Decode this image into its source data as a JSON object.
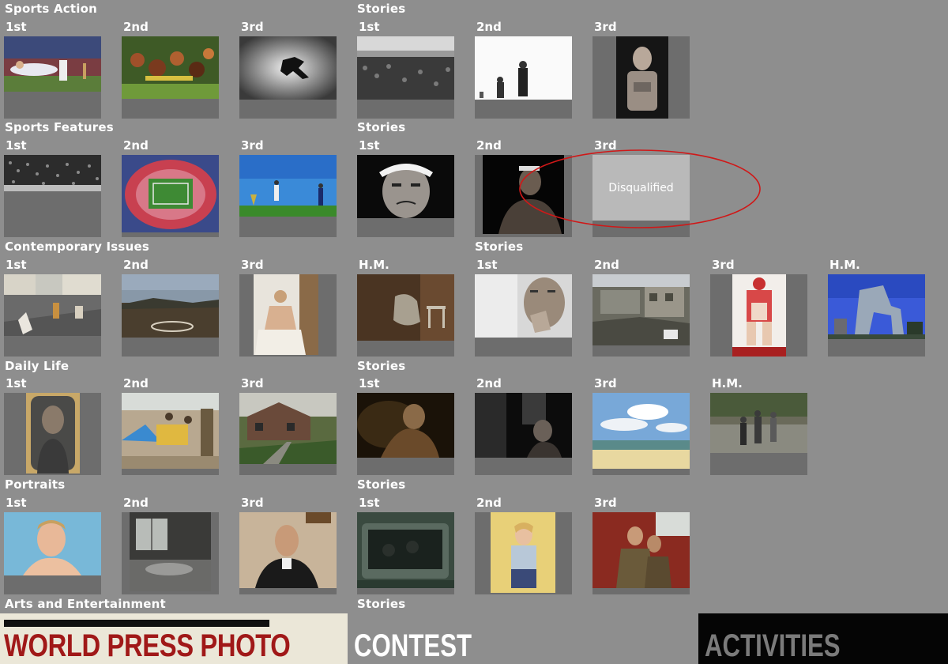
{
  "categories": [
    {
      "title": "Sports Action",
      "stories_title": "Stories",
      "singles": [
        {
          "rank": "1st",
          "photo": "cricket-catch"
        },
        {
          "rank": "2nd",
          "photo": "horse-race"
        },
        {
          "rank": "3rd",
          "photo": "diver-silhouette"
        }
      ],
      "stories": [
        {
          "rank": "1st",
          "photo": "crowd-waterfront"
        },
        {
          "rank": "2nd",
          "photo": "runners-white"
        },
        {
          "rank": "3rd",
          "photo": "athlete-portrait"
        }
      ]
    },
    {
      "title": "Sports Features",
      "stories_title": "Stories",
      "singles": [
        {
          "rank": "1st",
          "photo": "stadium-crowd"
        },
        {
          "rank": "2nd",
          "photo": "stadium-aerial"
        },
        {
          "rank": "3rd",
          "photo": "golfers-field"
        }
      ],
      "stories": [
        {
          "rank": "1st",
          "photo": "cyclist-face"
        },
        {
          "rank": "2nd",
          "photo": "boxer-dark"
        },
        {
          "rank": "3rd",
          "disqualified": "Disqualified"
        }
      ]
    },
    {
      "title": "Contemporary Issues",
      "stories_title": "Stories",
      "singles": [
        {
          "rank": "1st",
          "photo": "street-objects"
        },
        {
          "rank": "2nd",
          "photo": "field-landscape"
        },
        {
          "rank": "3rd",
          "photo": "woman-doorway"
        },
        {
          "rank": "H.M.",
          "photo": "chair-brown"
        }
      ],
      "stories": [
        {
          "rank": "1st",
          "photo": "man-thinking"
        },
        {
          "rank": "2nd",
          "photo": "wreckage"
        },
        {
          "rank": "3rd",
          "photo": "red-figure"
        },
        {
          "rank": "H.M.",
          "photo": "cctv-tower"
        }
      ]
    },
    {
      "title": "Daily Life",
      "stories_title": "Stories",
      "singles": [
        {
          "rank": "1st",
          "photo": "woman-window"
        },
        {
          "rank": "2nd",
          "photo": "market-scene"
        },
        {
          "rank": "3rd",
          "photo": "rural-house"
        }
      ],
      "stories": [
        {
          "rank": "1st",
          "photo": "girl-dark"
        },
        {
          "rank": "2nd",
          "photo": "dark-interior"
        },
        {
          "rank": "3rd",
          "photo": "beach-clouds"
        },
        {
          "rank": "H.M.",
          "photo": "kids-water"
        }
      ]
    },
    {
      "title": "Portraits",
      "stories_title": "Stories",
      "singles": [
        {
          "rank": "1st",
          "photo": "boy-portrait"
        },
        {
          "rank": "2nd",
          "photo": "bed-window"
        },
        {
          "rank": "3rd",
          "photo": "bald-man-suit"
        }
      ],
      "stories": [
        {
          "rank": "1st",
          "photo": "car-interior"
        },
        {
          "rank": "2nd",
          "photo": "woman-yellow"
        },
        {
          "rank": "3rd",
          "photo": "soldiers-train"
        }
      ]
    },
    {
      "title": "Arts and Entertainment",
      "stories_title": "Stories",
      "singles": [],
      "stories": []
    }
  ],
  "bottom_bar": {
    "logo_text": "WORLD PRESS PHOTO",
    "contest_label": "CONTEST",
    "activities_label": "ACTIVITIES"
  },
  "colors": {
    "background": "#8e8e8e",
    "frame": "#6d6d6d",
    "highlight_ellipse": "#d01818",
    "logo_red": "#a01818"
  }
}
